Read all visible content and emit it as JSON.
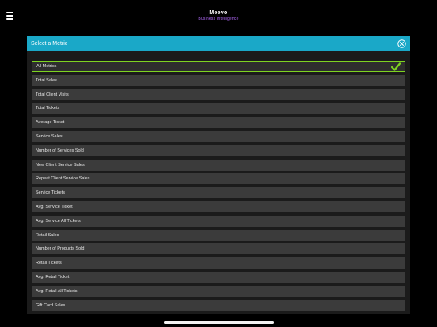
{
  "brand": {
    "name": "Meevo",
    "subtitle": "Business Intelligence",
    "subtitle_color": "#b56bff"
  },
  "dialog": {
    "title": "Select a Metric",
    "header_color": "#1aa8c8",
    "close_icon": "close-circle-icon",
    "selected_check_icon": "checkmark-icon",
    "check_color": "#7ed321"
  },
  "metrics": [
    {
      "label": "All Metrics",
      "selected": true
    },
    {
      "label": "Total Sales",
      "selected": false
    },
    {
      "label": "Total Client Visits",
      "selected": false
    },
    {
      "label": "Total Tickets",
      "selected": false
    },
    {
      "label": "Average Ticket",
      "selected": false
    },
    {
      "label": "Service Sales",
      "selected": false
    },
    {
      "label": "Number of Services Sold",
      "selected": false
    },
    {
      "label": "New Client Service Sales",
      "selected": false
    },
    {
      "label": "Repeat Client Service Sales",
      "selected": false
    },
    {
      "label": "Service Tickets",
      "selected": false
    },
    {
      "label": "Avg. Service Ticket",
      "selected": false
    },
    {
      "label": "Avg. Service All Tickets",
      "selected": false
    },
    {
      "label": "Retail Sales",
      "selected": false
    },
    {
      "label": "Number of Products Sold",
      "selected": false
    },
    {
      "label": "Retail Tickets",
      "selected": false
    },
    {
      "label": "Avg. Retail Ticket",
      "selected": false
    },
    {
      "label": "Avg. Retail All Tickets",
      "selected": false
    },
    {
      "label": "Gift Card Sales",
      "selected": false
    }
  ]
}
